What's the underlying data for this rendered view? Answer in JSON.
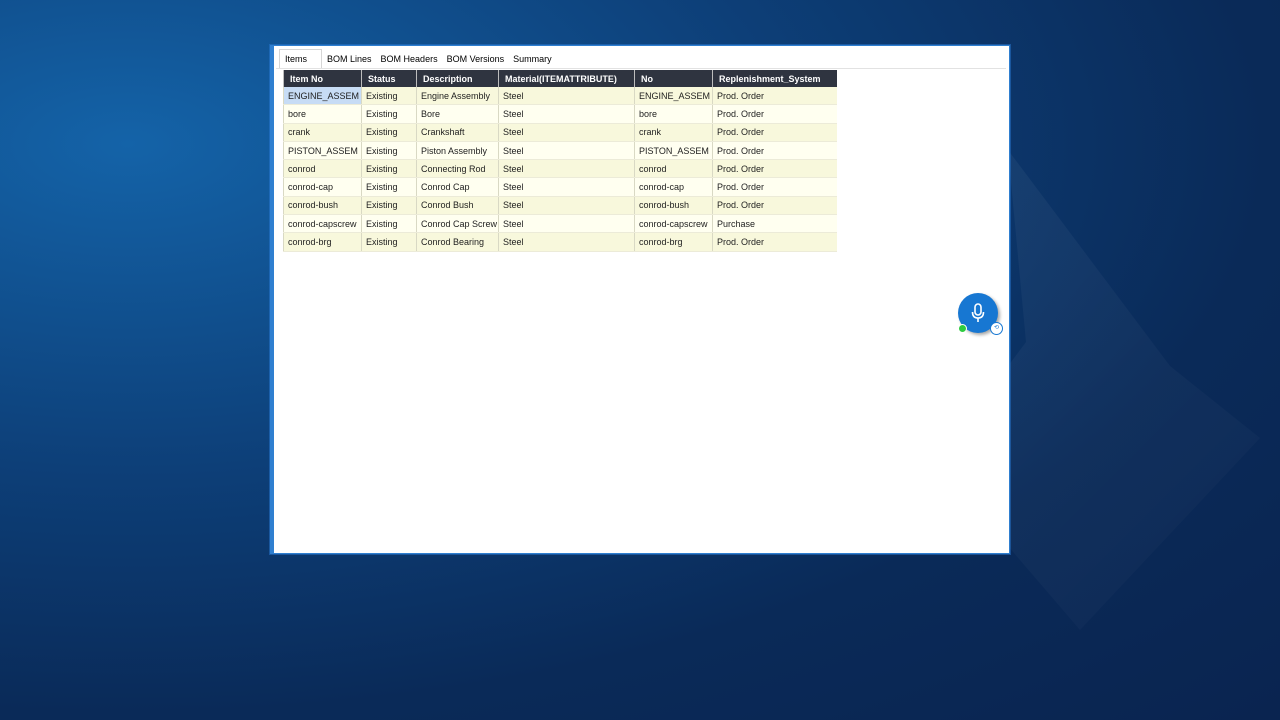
{
  "tabs": [
    {
      "label": "Items",
      "active": true
    },
    {
      "label": "BOM Lines",
      "active": false
    },
    {
      "label": "BOM Headers",
      "active": false
    },
    {
      "label": "BOM Versions",
      "active": false
    },
    {
      "label": "Summary",
      "active": false
    }
  ],
  "table": {
    "columns": [
      "Item No",
      "Status",
      "Description",
      "Material(ITEMATTRIBUTE)",
      "No",
      "Replenishment_System"
    ],
    "rows": [
      [
        "ENGINE_ASSEM",
        "Existing",
        "Engine Assembly",
        "Steel",
        "ENGINE_ASSEM",
        "Prod. Order"
      ],
      [
        "bore",
        "Existing",
        "Bore",
        "Steel",
        "bore",
        "Prod. Order"
      ],
      [
        "crank",
        "Existing",
        "Crankshaft",
        "Steel",
        "crank",
        "Prod. Order"
      ],
      [
        "PISTON_ASSEM",
        "Existing",
        "Piston Assembly",
        "Steel",
        "PISTON_ASSEM",
        "Prod. Order"
      ],
      [
        "conrod",
        "Existing",
        "Connecting Rod",
        "Steel",
        "conrod",
        "Prod. Order"
      ],
      [
        "conrod-cap",
        "Existing",
        "Conrod Cap",
        "Steel",
        "conrod-cap",
        "Prod. Order"
      ],
      [
        "conrod-bush",
        "Existing",
        "Conrod Bush",
        "Steel",
        "conrod-bush",
        "Prod. Order"
      ],
      [
        "conrod-capscrew",
        "Existing",
        "Conrod Cap Screw",
        "Steel",
        "conrod-capscrew",
        "Purchase"
      ],
      [
        "conrod-brg",
        "Existing",
        "Conrod Bearing",
        "Steel",
        "conrod-brg",
        "Prod. Order"
      ]
    ],
    "selected_cell": "ENGINE_ASSEM"
  },
  "voice": {
    "icon": "microphone-icon",
    "status_color": "#2ecc40",
    "badge_icon": "language-badge-icon"
  },
  "colors": {
    "header_bg": "#2f3440",
    "row_odd": "#f8f8dc",
    "row_even": "#fffff0",
    "selection": "#c7dcf5",
    "accent": "#1777d2"
  }
}
